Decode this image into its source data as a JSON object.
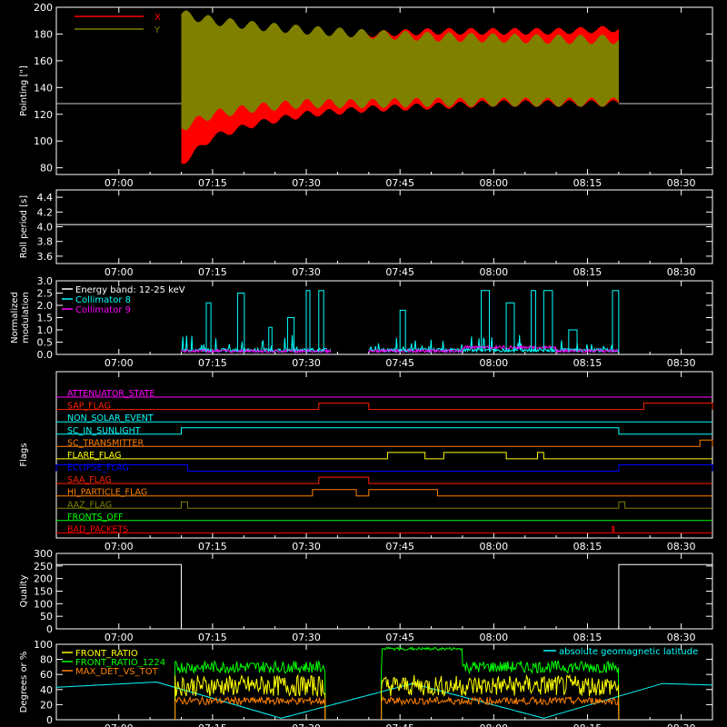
{
  "time_axis": {
    "start": "06:50",
    "end": "08:35",
    "tick_labels": [
      "07:00",
      "07:15",
      "07:30",
      "07:45",
      "08:00",
      "08:15",
      "08:30"
    ]
  },
  "chart_data": [
    {
      "id": "pointing",
      "type": "area",
      "ylabel": "Pointing [\"]",
      "ylim": [
        75,
        200
      ],
      "yticks": [
        "80",
        "100",
        "120",
        "140",
        "160",
        "180",
        "200"
      ],
      "legend": "top-left",
      "legend_entries": [
        "X",
        "Y"
      ],
      "colors": {
        "X": "#ff0000",
        "Y": "#808000",
        "baseline": "#c8c8c8"
      },
      "active_range": [
        "07:10",
        "08:20"
      ],
      "baseline": 128,
      "x": [
        "07:10",
        "07:15",
        "07:22",
        "07:30",
        "07:40",
        "07:50",
        "08:00",
        "08:10",
        "08:20"
      ],
      "series": [
        {
          "name": "X",
          "max": [
            175,
            178,
            180,
            180,
            180,
            182,
            182,
            182,
            184
          ],
          "min": [
            83,
            103,
            113,
            120,
            124,
            126,
            128,
            128,
            128
          ]
        },
        {
          "name": "Y",
          "max": [
            195,
            190,
            186,
            183,
            180,
            178,
            177,
            176,
            176
          ],
          "min": [
            110,
            120,
            125,
            128,
            128,
            129,
            129,
            129,
            129
          ]
        }
      ]
    },
    {
      "id": "roll_period",
      "type": "line",
      "ylabel": "Roll period [s]",
      "ylim": [
        3.5,
        4.5
      ],
      "yticks": [
        "3.6",
        "3.8",
        "4.0",
        "4.2",
        "4.4"
      ],
      "value": 4.03,
      "color": "#ffffff"
    },
    {
      "id": "modulation",
      "type": "line",
      "ylabel": "Normalized modulation",
      "ylim": [
        0,
        3
      ],
      "yticks": [
        "0.0",
        "0.5",
        "1.0",
        "1.5",
        "2.0",
        "2.5",
        "3.0"
      ],
      "legend": "top-left",
      "legend_entries": [
        "Energy band: 12-25 keV",
        "Collimator 8",
        "Collimator 9"
      ],
      "colors": {
        "Energy band: 12-25 keV": "#ffffff",
        "Collimator 8": "#00ffff",
        "Collimator 9": "#ff00ff"
      },
      "active_ranges": [
        [
          "07:10",
          "07:34"
        ],
        [
          "07:40",
          "08:20"
        ]
      ],
      "spikes": [
        [
          "07:14",
          2.1
        ],
        [
          "07:19",
          2.5
        ],
        [
          "07:24",
          1.1
        ],
        [
          "07:27",
          1.5
        ],
        [
          "07:30",
          2.6
        ],
        [
          "07:32",
          2.6
        ],
        [
          "07:45",
          1.8
        ],
        [
          "07:58",
          2.6
        ],
        [
          "08:02",
          2.1
        ],
        [
          "08:06",
          2.6
        ],
        [
          "08:08",
          2.6
        ],
        [
          "08:12",
          1.0
        ],
        [
          "08:19",
          2.6
        ]
      ]
    },
    {
      "id": "flags",
      "type": "step",
      "ylabel": "Flags",
      "flags": [
        {
          "name": "ATTENUATOR_STATE",
          "color": "#ff00ff",
          "segments": []
        },
        {
          "name": "SAP_FLAG",
          "color": "#ff2000",
          "segments": [
            [
              "07:32",
              "07:40"
            ],
            [
              "08:24",
              "08:35"
            ]
          ]
        },
        {
          "name": "NON_SOLAR_EVENT",
          "color": "#00ffff",
          "segments": []
        },
        {
          "name": "SC_IN_SUNLIGHT",
          "color": "#00ffff",
          "segments": [
            [
              "07:10",
              "08:20"
            ]
          ]
        },
        {
          "name": "SC_TRANSMITTER",
          "color": "#ff8000",
          "segments": [
            [
              "08:33",
              "08:35"
            ]
          ]
        },
        {
          "name": "FLARE_FLAG",
          "color": "#ffff00",
          "segments": [
            [
              "07:43",
              "07:49"
            ],
            [
              "07:52",
              "08:02"
            ],
            [
              "08:07",
              "08:08"
            ]
          ]
        },
        {
          "name": "ECLIPSE_FLAG",
          "color": "#0000ff",
          "segments": [
            [
              "06:50",
              "07:11"
            ],
            [
              "08:20",
              "08:35"
            ]
          ]
        },
        {
          "name": "SAA_FLAG",
          "color": "#ff2000",
          "segments": [
            [
              "07:32",
              "07:40"
            ]
          ]
        },
        {
          "name": "HI_PARTICLE_FLAG",
          "color": "#ff8000",
          "segments": [
            [
              "07:31",
              "07:38"
            ],
            [
              "07:40",
              "07:51"
            ]
          ]
        },
        {
          "name": "AAZ_FLAG",
          "color": "#808000",
          "segments": [
            [
              "07:10",
              "07:11"
            ],
            [
              "08:20",
              "08:21"
            ]
          ]
        },
        {
          "name": "FRONTS_OFF",
          "color": "#00ff00",
          "segments": []
        },
        {
          "name": "BAD_PACKETS",
          "color": "#ff0000",
          "segments": [
            [
              "08:19",
              "08:19"
            ]
          ]
        }
      ]
    },
    {
      "id": "quality",
      "type": "step",
      "ylabel": "Quality",
      "ylim": [
        0,
        300
      ],
      "yticks": [
        "0",
        "50",
        "100",
        "150",
        "200",
        "250",
        "300"
      ],
      "color": "#ffffff",
      "segments": [
        [
          "06:50",
          "07:10",
          256
        ],
        [
          "07:10",
          "08:20",
          0
        ],
        [
          "08:20",
          "08:35",
          256
        ]
      ]
    },
    {
      "id": "ratios",
      "type": "line",
      "ylabel": "Degrees or %",
      "ylim": [
        0,
        100
      ],
      "yticks": [
        "0",
        "20",
        "40",
        "60",
        "80",
        "100"
      ],
      "legend": "top-left",
      "legend_entries": [
        "FRONT_RATIO",
        "FRONT_RATIO_1224",
        "MAX_DET_VS_TOT"
      ],
      "annotation": "absolute geomagnetic latitude",
      "colors": {
        "FRONT_RATIO": "#ffff00",
        "FRONT_RATIO_1224": "#00ff00",
        "MAX_DET_VS_TOT": "#ff8000",
        "absolute geomagnetic latitude": "#00ffff"
      },
      "active_ranges": [
        [
          "07:09",
          "07:33"
        ],
        [
          "07:42",
          "08:20"
        ]
      ],
      "series": [
        {
          "name": "FRONT_RATIO_1224",
          "level": 70
        },
        {
          "name": "FRONT_RATIO",
          "level": 45
        },
        {
          "name": "MAX_DET_VS_TOT",
          "level": 25
        }
      ],
      "latitude": {
        "x": [
          "06:50",
          "07:06",
          "07:26",
          "07:47",
          "08:08",
          "08:27",
          "08:35"
        ],
        "y": [
          43,
          50,
          2,
          48,
          2,
          48,
          46
        ]
      }
    }
  ]
}
